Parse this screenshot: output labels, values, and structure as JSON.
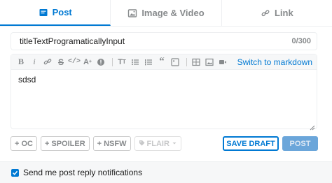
{
  "tabs": [
    {
      "label": "Post",
      "icon": "post-icon",
      "active": true
    },
    {
      "label": "Image & Video",
      "icon": "image-icon",
      "active": false
    },
    {
      "label": "Link",
      "icon": "link-icon",
      "active": false
    }
  ],
  "title": {
    "value": "titleTextProgramaticallyInput",
    "counter": "0/300"
  },
  "editor": {
    "toolbar_icons": [
      "bold-icon",
      "italic-icon",
      "link-icon",
      "strikethrough-icon",
      "code-icon",
      "superscript-icon",
      "spoiler-icon",
      "heading-icon",
      "bulleted-list-icon",
      "numbered-list-icon",
      "quote-icon",
      "code-block-icon",
      "table-icon",
      "image-icon",
      "video-icon"
    ],
    "markdown_link": "Switch to markdown",
    "body": "sdsd"
  },
  "flags": {
    "oc": "OC",
    "spoiler": "SPOILER",
    "nsfw": "NSFW",
    "flair": "FLAIR"
  },
  "actions": {
    "save_draft": "SAVE DRAFT",
    "post": "POST"
  },
  "notify": {
    "label": "Send me post reply notifications",
    "checked": true
  },
  "colors": {
    "accent": "#0079d3",
    "post_disabled": "#6ba6da",
    "muted": "#878a8c"
  }
}
